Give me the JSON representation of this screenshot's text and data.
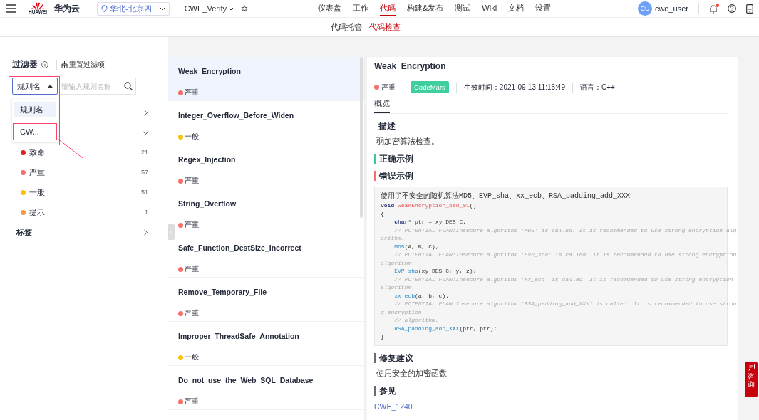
{
  "topbar": {
    "brand": "华为云",
    "logo_text": "HUAWEI",
    "region": "华北-北京四",
    "project": "CWE_Verify",
    "nav": [
      {
        "label": "仪表盘",
        "selected": false
      },
      {
        "label": "工作",
        "selected": false
      },
      {
        "label": "代码",
        "selected": true
      },
      {
        "label": "构建&发布",
        "selected": false
      },
      {
        "label": "测试",
        "selected": false
      },
      {
        "label": "Wiki",
        "selected": false
      },
      {
        "label": "文档",
        "selected": false
      },
      {
        "label": "设置",
        "selected": false
      }
    ],
    "avatar": "CU",
    "user": "cwe_user",
    "has_notification": true
  },
  "subnav": [
    {
      "label": "代码托管",
      "selected": false
    },
    {
      "label": "代码检查",
      "selected": true
    }
  ],
  "filter": {
    "title": "过滤器",
    "reset": "重置过滤项",
    "select_value": "规则名",
    "select_open": true,
    "search_placeholder": "请输入规则名称",
    "dropdown": [
      {
        "label": "规则名",
        "selected": true,
        "annotated": false
      },
      {
        "label": "CW...",
        "selected": false,
        "annotated": true
      }
    ],
    "groups": [
      {
        "expanded": false
      },
      {
        "expanded": true,
        "options": [
          {
            "label": "致命",
            "count": "21",
            "color": "#e0231b"
          },
          {
            "label": "严重",
            "count": "57",
            "color": "#f66f6a"
          },
          {
            "label": "一般",
            "count": "51",
            "color": "#fac20a"
          },
          {
            "label": "提示",
            "count": "1",
            "color": "#fa9841"
          }
        ]
      },
      {
        "label": "标签",
        "expanded": false
      }
    ]
  },
  "rules": [
    {
      "name": "Weak_Encryption",
      "severity": "严重",
      "color": "#f66f6a",
      "selected": true
    },
    {
      "name": "Integer_Overflow_Before_Widen",
      "severity": "一般",
      "color": "#fac20a",
      "selected": false
    },
    {
      "name": "Regex_Injection",
      "severity": "严重",
      "color": "#f66f6a",
      "selected": false
    },
    {
      "name": "String_Overflow",
      "severity": "严重",
      "color": "#f66f6a",
      "selected": false
    },
    {
      "name": "Safe_Function_DestSize_Incorrect",
      "severity": "严重",
      "color": "#f66f6a",
      "selected": false
    },
    {
      "name": "Remove_Temporary_File",
      "severity": "严重",
      "color": "#f66f6a",
      "selected": false
    },
    {
      "name": "Improper_ThreadSafe_Annotation",
      "severity": "一般",
      "color": "#fac20a",
      "selected": false
    },
    {
      "name": "Do_not_use_the_Web_SQL_Database",
      "severity": "严重",
      "color": "#f66f6a",
      "selected": false
    }
  ],
  "detail": {
    "title": "Weak_Encryption",
    "severity": "严重",
    "color": "#f66f6a",
    "tag": "CodeMars",
    "effective": "生效时间：2021-09-13 11:15:49",
    "language": "语言：C++",
    "tabs": [
      {
        "label": "概览",
        "selected": true
      }
    ],
    "sections": [
      {
        "kind": "text",
        "heading": "描述",
        "text": "弱加密算法检查。"
      },
      {
        "kind": "empty",
        "heading": "正确示例",
        "color": "#3fc59a"
      },
      {
        "kind": "code",
        "heading": "错误示例",
        "color": "#f66f6a",
        "lines": [
          {
            "kind": "caption",
            "segments": [
              {
                "kind": "plain",
                "text": "使用了不安全的随机算法MD5、EVP_sha、xx_ecb、RSA_padding_add_XXX"
              }
            ]
          },
          {
            "segments": [
              {
                "kind": "keyword",
                "text": "void"
              },
              {
                "kind": "title",
                "text": "weakEncryption_bad_01"
              },
              {
                "kind": "plain",
                "text": "()"
              }
            ]
          },
          {
            "segments": [
              {
                "kind": "plain",
                "text": "{"
              }
            ]
          },
          {
            "segments": [
              {
                "kind": "keyword",
                "text": "    char*"
              },
              {
                "kind": "plain",
                "text": " ptr = xy_DES_C;"
              }
            ]
          },
          {
            "segments": [
              {
                "kind": "comment",
                "text": "    // POTENTIAL FLAW:Insecure algorithm 'MD5' is called. It is recommended to use strong encryption alg"
              }
            ]
          },
          {
            "segments": [
              {
                "kind": "comment",
                "text": "orithm."
              }
            ]
          },
          {
            "segments": [
              {
                "kind": "call",
                "text": "    MD5"
              },
              {
                "kind": "plain",
                "text": "(A, B, C);"
              }
            ]
          },
          {
            "segments": [
              {
                "kind": "comment",
                "text": "    // POTENTIAL FLAW:Insecure algorithm 'EVP_sha' is called. It is recommended to use strong encryption"
              }
            ]
          },
          {
            "segments": [
              {
                "kind": "comment",
                "text": "algorithm."
              }
            ]
          },
          {
            "segments": [
              {
                "kind": "call",
                "text": "    EVP_sha"
              },
              {
                "kind": "plain",
                "text": "(xy_DES_C, y, z);"
              }
            ]
          },
          {
            "segments": [
              {
                "kind": "comment",
                "text": "    // POTENTIAL FLAW:Insecure algorithm 'xx_ecb' is called. It is recommended to use strong encryption"
              }
            ]
          },
          {
            "segments": [
              {
                "kind": "comment",
                "text": "algorithm."
              }
            ]
          },
          {
            "segments": [
              {
                "kind": "call",
                "text": "    xx_ecb"
              },
              {
                "kind": "plain",
                "text": "(a, b, c);"
              }
            ]
          },
          {
            "segments": [
              {
                "kind": "comment",
                "text": "    // POTENTIAL FLAW:Insecure algorithm 'RSA_padding_add_XXX' is called. It is recommended to use stron"
              }
            ]
          },
          {
            "segments": [
              {
                "kind": "comment",
                "text": "g encryption"
              }
            ]
          },
          {
            "segments": [
              {
                "kind": "comment",
                "text": "    // algorithm."
              }
            ]
          },
          {
            "segments": [
              {
                "kind": "call",
                "text": "    RSA_padding_add_XXX"
              },
              {
                "kind": "plain",
                "text": "(ptr, ptr);"
              }
            ]
          },
          {
            "segments": [
              {
                "kind": "plain",
                "text": "}"
              }
            ]
          }
        ]
      },
      {
        "kind": "text",
        "heading": "修复建议",
        "color": "#6b6b6b",
        "text": "使用安全的加密函数"
      },
      {
        "kind": "link",
        "heading": "参见",
        "color": "#6b6b6b",
        "text": "CWE_1240"
      }
    ]
  },
  "consult": "咨询"
}
